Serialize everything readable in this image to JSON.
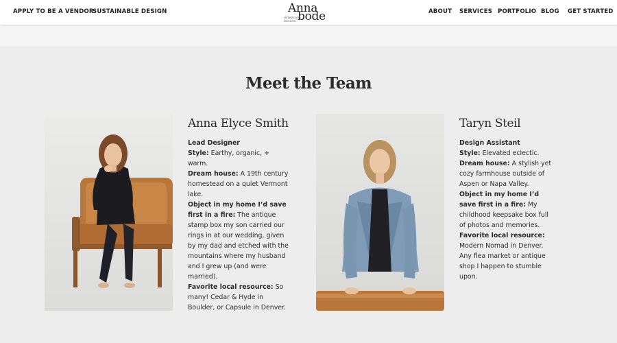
{
  "nav": {
    "left": [
      "APPLY TO BE A VENDOR",
      "SUSTAINABLE DESIGN"
    ],
    "logo": {
      "line1": "Anna",
      "line2": "bode",
      "tagline": "INTERIOR DESIGN"
    },
    "right": [
      "ABOUT",
      "SERVICES",
      "PORTFOLIO",
      "BLOG",
      "GET STARTED"
    ]
  },
  "section": {
    "title": "Meet the Team"
  },
  "team": [
    {
      "name": "Anna Elyce Smith",
      "role": "Lead Designer",
      "style_label": "Style:",
      "style": " Earthy, organic, + warm.",
      "dream_label": "Dream house:",
      "dream": " A 19th century homestead on a quiet Vermont lake.",
      "object_label": "Object in my home I’d save first in a fire:",
      "object": " The antique stamp box my son carried our rings in at our wedding, given by my dad and etched with the mountains where my husband and I grew up (and were married).",
      "resource_label": "Favorite local resource:",
      "resource": " So many! Cedar & Hyde in Boulder, or Capsule in Denver."
    },
    {
      "name": "Taryn Steil",
      "role": "Design Assistant",
      "style_label": "Style:",
      "style": " Elevated eclectic.",
      "dream_label": "Dream house:",
      "dream": " A stylish yet cozy farmhouse outside of Aspen or Napa Valley.",
      "object_label": "Object in my home I’d save first in a fire:",
      "object": " My childhood keepsake box full of photos and memories.",
      "resource_label": "Favorite local resource:",
      "resource": " Modern Nomad in Denver. Any flea market or antique shop I happen to stumble upon."
    }
  ]
}
